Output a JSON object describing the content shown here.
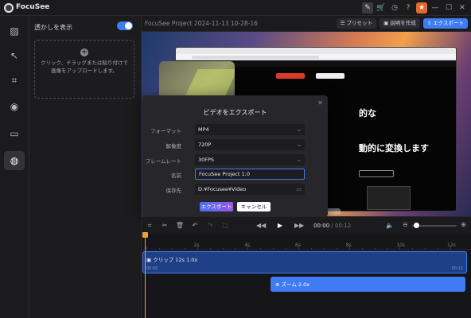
{
  "app": {
    "name": "FocuSee"
  },
  "titlebar_icons": [
    "brush-icon",
    "cart-icon",
    "clock-icon",
    "help-icon",
    "gift-icon",
    "minimize-icon",
    "maximize-icon",
    "close-icon"
  ],
  "rail": {
    "items": [
      "aspect-icon",
      "cursor-icon",
      "camera-icon",
      "webcam-icon",
      "caption-icon",
      "background-icon"
    ],
    "active_index": 5
  },
  "panel": {
    "title": "透かしを表示",
    "toggle_on": true,
    "dropzone_line1": "クリック、ドラッグまたは貼り付けで",
    "dropzone_line2": "画像をアップロードします。"
  },
  "header": {
    "project_title": "FocuSee Project 2024-11-13 10-28-16",
    "preset_label": "プリセット",
    "tutorial_label": "説明を作成",
    "export_label": "エクスポート"
  },
  "web": {
    "headline1": "的な",
    "headline2": "動的に変換します"
  },
  "dialog": {
    "title": "ビデオをエクスポート",
    "format_label": "フォーマット",
    "format_value": "MP4",
    "resolution_label": "解像度",
    "resolution_value": "720P",
    "framerate_label": "フレームレート",
    "framerate_value": "30FPS",
    "name_label": "名前",
    "name_value": "FocuSee Project 1.0",
    "path_label": "保存先",
    "path_value": "D:¥Focusee¥Video",
    "export_button": "エクスポート",
    "cancel_button": "キャンセル"
  },
  "playback": {
    "current_time": "00:00",
    "separator": "/",
    "total_time": "00:12"
  },
  "timeline": {
    "ticks": [
      "0s",
      "2s",
      "4s",
      "6s",
      "8s",
      "10s",
      "12s"
    ],
    "clip_label": "クリップ",
    "clip_duration": "12s",
    "clip_speed": "1.0x",
    "clip_start": "00:00",
    "clip_end": "00:11",
    "zoom_label": "ズーム",
    "zoom_value": "2.0x"
  },
  "colors": {
    "accent": "#3f7cf4",
    "playhead": "#f0a030",
    "background": "#161618"
  }
}
